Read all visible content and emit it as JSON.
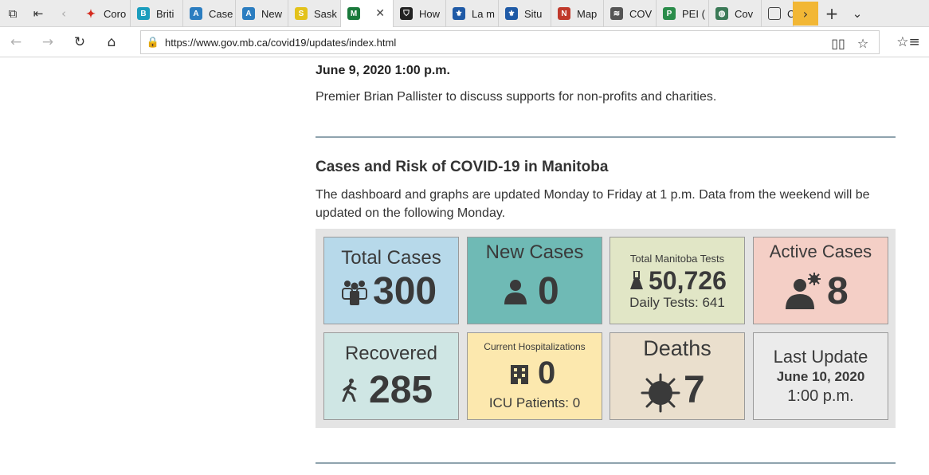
{
  "browser": {
    "tabs": [
      {
        "label": "Coro",
        "icon": "maple-leaf-icon",
        "color": "#d52b1e"
      },
      {
        "label": "Briti",
        "icon": "bc-logo-icon",
        "color": "#1b9dbd"
      },
      {
        "label": "Case",
        "icon": "alberta-icon",
        "color": "#2b7dc0"
      },
      {
        "label": "New",
        "icon": "alberta-icon",
        "color": "#2b7dc0"
      },
      {
        "label": "Sask",
        "icon": "saskatchewan-icon",
        "color": "#e3c21a"
      },
      {
        "label": "",
        "icon": "manitoba-icon",
        "color": "#1a7a3c",
        "active": true
      },
      {
        "label": "How",
        "icon": "shield-icon",
        "color": "#222222"
      },
      {
        "label": "La m",
        "icon": "quebec-icon",
        "color": "#1f5aa6"
      },
      {
        "label": "Situ",
        "icon": "quebec-icon",
        "color": "#1f5aa6"
      },
      {
        "label": "Map",
        "icon": "nb-map-icon",
        "color": "#c0392b"
      },
      {
        "label": "COV",
        "icon": "ns-icon",
        "color": "#555555"
      },
      {
        "label": "PEI (",
        "icon": "pei-icon",
        "color": "#2a8c4a"
      },
      {
        "label": "Cov",
        "icon": "globe-icon",
        "color": "#3b7a57"
      },
      {
        "label": "C",
        "icon": "window-icon",
        "color": "#444444"
      }
    ]
  },
  "address": {
    "url": "https://www.gov.mb.ca/covid19/updates/index.html"
  },
  "page": {
    "update_date": "June 9, 2020 1:00 p.m.",
    "update_text": "Premier Brian Pallister to discuss supports for non-profits and charities.",
    "section_title": "Cases and Risk of COVID-19 in Manitoba",
    "section_desc": "The dashboard and graphs are updated Monday to Friday at 1 p.m. Data from the weekend will be updated on the following Monday."
  },
  "dashboard": {
    "total_cases": {
      "label": "Total Cases",
      "value": "300",
      "color": "#b7d9ea",
      "icon": "people-icon"
    },
    "new_cases": {
      "label": "New Cases",
      "value": "0",
      "color": "#6fbab5",
      "icon": "person-icon"
    },
    "tests": {
      "label": "Total Manitoba Tests",
      "value": "50,726",
      "daily": "Daily Tests: 641",
      "color": "#e1e6c6",
      "icon": "flask-icon"
    },
    "active": {
      "label": "Active Cases",
      "value": "8",
      "color": "#f4cfc6",
      "icon": "person-virus-icon"
    },
    "recovered": {
      "label": "Recovered",
      "value": "285",
      "color": "#cfe6e4",
      "icon": "walking-icon"
    },
    "hospital": {
      "label": "Current Hospitalizations",
      "value": "0",
      "icu": "ICU Patients: 0",
      "color": "#fce8ae",
      "icon": "hospital-icon"
    },
    "deaths": {
      "label": "Deaths",
      "value": "7",
      "color": "#eadfcd",
      "icon": "virus-icon"
    },
    "last_update": {
      "label": "Last Update",
      "date": "June 10, 2020",
      "time": "1:00 p.m.",
      "color": "#ebebeb"
    }
  }
}
